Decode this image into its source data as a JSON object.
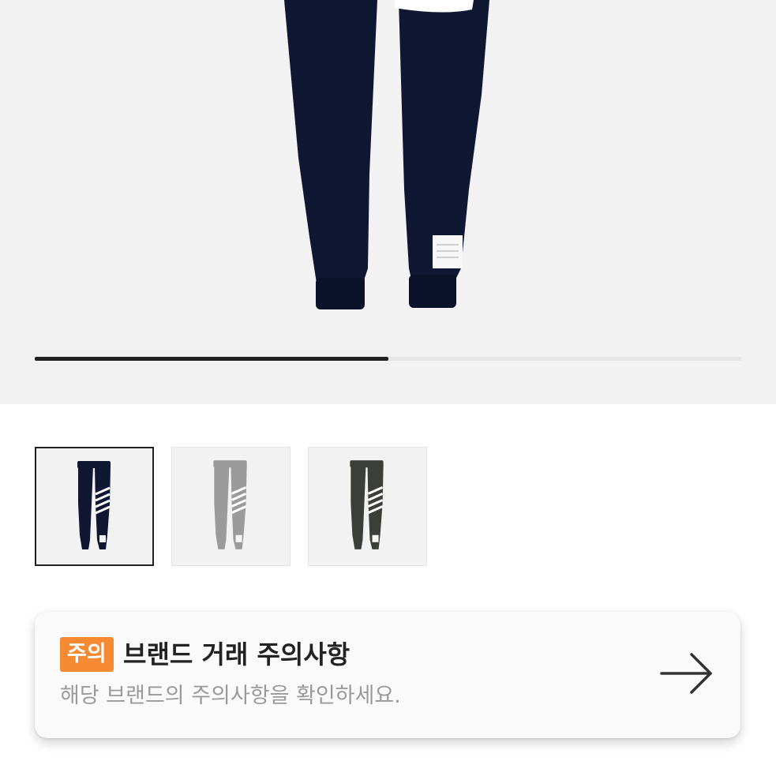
{
  "gallery": {
    "progress_fraction": 0.5,
    "colors": {
      "navy": "#0f1733",
      "grey": "#9b9b9b",
      "charcoal": "#3c3f39",
      "stripe": "#ffffff"
    }
  },
  "thumbnails": [
    {
      "variant": "navy",
      "selected": true
    },
    {
      "variant": "grey",
      "selected": false
    },
    {
      "variant": "charcoal",
      "selected": false
    }
  ],
  "notice": {
    "badge": "주의",
    "title": "브랜드 거래 주의사항",
    "subtitle": "해당 브랜드의 주의사항을 확인하세요.",
    "badge_color": "#f58a32",
    "action_icon": "arrow-right-icon"
  }
}
